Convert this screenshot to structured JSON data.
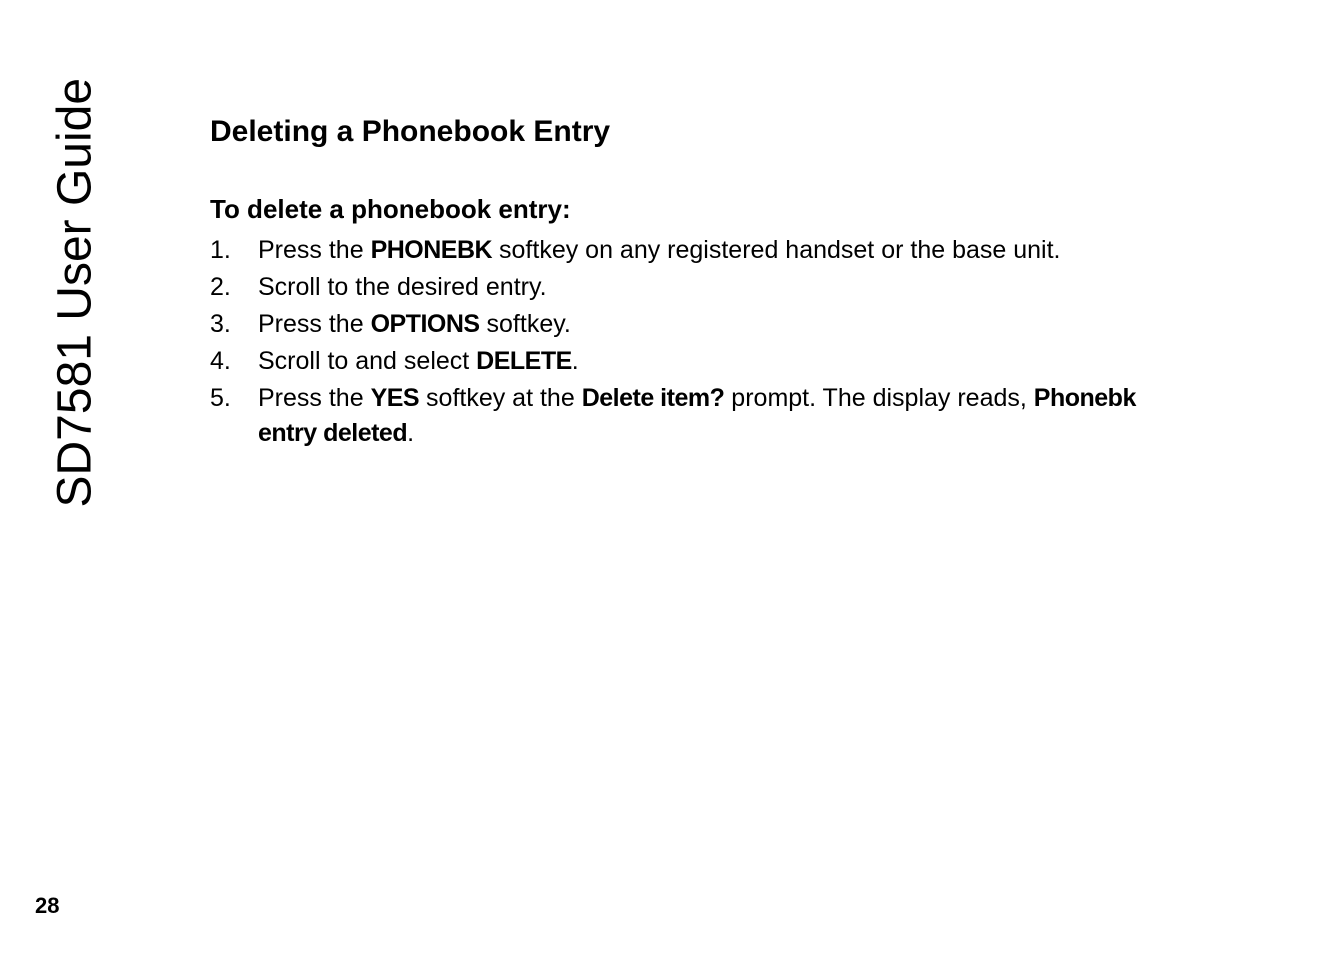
{
  "sidebar": {
    "guide_title": "SD7581 User Guide"
  },
  "page": {
    "number": "28"
  },
  "section": {
    "title": "Deleting a Phonebook Entry",
    "subsection_title": "To delete a phonebook entry:"
  },
  "steps": [
    {
      "num": "1.",
      "text_before": "Press the ",
      "bold1": "PHONEBK",
      "text_after": " softkey on any registered handset or the base unit."
    },
    {
      "num": "2.",
      "text_before": "Scroll to the desired entry.",
      "bold1": "",
      "text_after": ""
    },
    {
      "num": "3.",
      "text_before": "Press the ",
      "bold1": "OPTIONS",
      "text_after": " softkey."
    },
    {
      "num": "4.",
      "text_before": "Scroll to and select ",
      "bold1": "DELETE",
      "text_after": "."
    },
    {
      "num": "5.",
      "text_before": "Press the ",
      "bold1": "YES",
      "text_mid1": " softkey at the ",
      "bold2": "Delete item?",
      "text_mid2": " prompt. The display reads, ",
      "bold3": "Phonebk entry deleted",
      "text_after": "."
    }
  ]
}
